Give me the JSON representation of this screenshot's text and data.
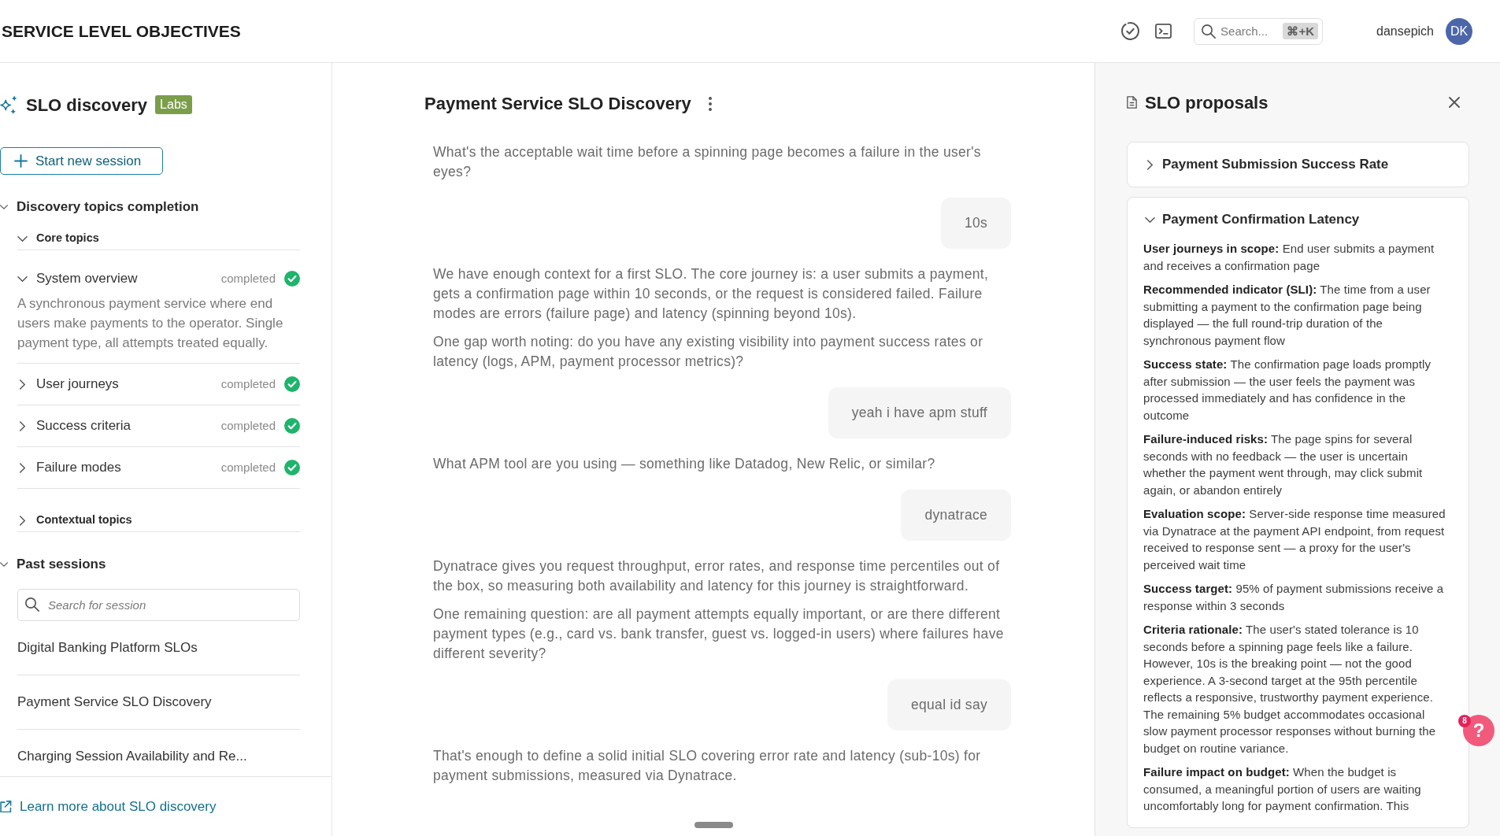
{
  "header": {
    "title": "SERVICE LEVEL OBJECTIVES",
    "search": {
      "placeholder": "Search...",
      "shortcut": "⌘+K"
    },
    "user": {
      "name": "dansepich",
      "initials": "DK"
    }
  },
  "sidebar": {
    "title": "SLO discovery",
    "badge": "Labs",
    "new_session_button": "Start new session",
    "topics": {
      "label": "Discovery topics completion",
      "expanded": true,
      "groups": [
        {
          "label": "Core topics",
          "expanded": true,
          "children": [
            {
              "label": "System overview",
              "status": "completed",
              "completed": true,
              "expanded": true,
              "description": "A synchronous payment service where end users make payments to the operator. Single payment type, all attempts treated equally."
            },
            {
              "label": "User journeys",
              "status": "completed",
              "completed": true,
              "expanded": false
            },
            {
              "label": "Success criteria",
              "status": "completed",
              "completed": true,
              "expanded": false
            },
            {
              "label": "Failure modes",
              "status": "completed",
              "completed": true,
              "expanded": false
            }
          ]
        },
        {
          "label": "Contextual topics",
          "expanded": false
        }
      ]
    },
    "past_sessions": {
      "label": "Past sessions",
      "expanded": true,
      "search": {
        "placeholder": "Search for session"
      },
      "items": [
        "Digital Banking Platform SLOs",
        "Payment Service SLO Discovery",
        "Charging Session Availability and Re..."
      ]
    },
    "footer_link": "Learn more about SLO discovery"
  },
  "chat": {
    "title": "Payment Service SLO Discovery",
    "messages": [
      {
        "kind": "assistant",
        "paragraphs": [
          "What's the acceptable wait time before a spinning page becomes a failure in the user's eyes?"
        ]
      },
      {
        "kind": "user",
        "text": "10s"
      },
      {
        "kind": "assistant",
        "paragraphs": [
          "We have enough context for a first SLO. The core journey is: a user submits a payment, gets a confirmation page within 10 seconds, or the request is considered failed. Failure modes are errors (failure page) and latency (spinning beyond 10s).",
          "One gap worth noting: do you have any existing visibility into payment success rates or latency (logs, APM, payment processor metrics)?"
        ]
      },
      {
        "kind": "user",
        "text": "yeah i have apm stuff"
      },
      {
        "kind": "assistant",
        "paragraphs": [
          "What APM tool are you using — something like Datadog, New Relic, or similar?"
        ]
      },
      {
        "kind": "user",
        "text": "dynatrace"
      },
      {
        "kind": "assistant",
        "paragraphs": [
          "Dynatrace gives you request throughput, error rates, and response time percentiles out of the box, so measuring both availability and latency for this journey is straightforward.",
          "One remaining question: are all payment attempts equally important, or are there different payment types (e.g., card vs. bank transfer, guest vs. logged-in users) where failures have different severity?"
        ]
      },
      {
        "kind": "user",
        "text": "equal id say"
      },
      {
        "kind": "assistant",
        "paragraphs": [
          "That's enough to define a solid initial SLO covering error rate and latency (sub-10s) for payment submissions, measured via Dynatrace."
        ]
      }
    ]
  },
  "proposals": {
    "title": "SLO proposals",
    "items": [
      {
        "title": "Payment Submission Success Rate",
        "expanded": false
      },
      {
        "title": "Payment Confirmation Latency",
        "expanded": true,
        "fields": [
          "**User journeys in scope:** End user submits a payment and receives a confirmation page",
          "**Recommended indicator (SLI):** The time from a user submitting a payment to the confirmation page being displayed — the full round-trip duration of the synchronous payment flow",
          "**Success state:** The confirmation page loads promptly after submission — the user feels the payment was processed immediately and has confidence in the outcome",
          "**Failure-induced risks:** The page spins for several seconds with no feedback — the user is uncertain whether the payment went through, may click submit again, or abandon entirely",
          "**Evaluation scope:** Server-side response time measured via Dynatrace at the payment API endpoint, from request received to response sent — a proxy for the user's perceived wait time",
          "**Success target:** 95% of payment submissions receive a response within 3 seconds",
          "**Criteria rationale:** The user's stated tolerance is 10 seconds before a spinning page feels like a failure. However, 10s is the breaking point — not the good experience. A 3-second target at the 95th percentile reflects a responsive, trustworthy payment experience. The remaining 5% budget accommodates occasional slow payment processor responses without burning the budget on routine variance.",
          "**Failure impact on budget:** When the budget is consumed, a meaningful portion of users are waiting uncomfortably long for payment confirmation. This"
        ]
      }
    ]
  },
  "help_button": {
    "label": "?",
    "badge": "8"
  }
}
